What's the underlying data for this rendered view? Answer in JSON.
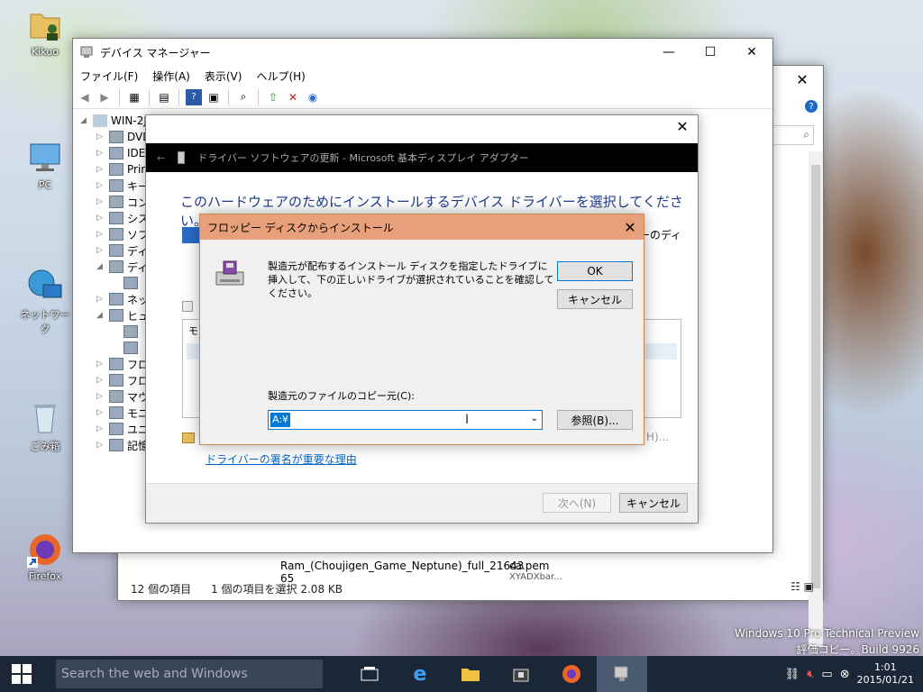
{
  "desktop": {
    "icons": [
      {
        "label": "Kikuo"
      },
      {
        "label": "PC"
      },
      {
        "label": "ネットワーク"
      },
      {
        "label": "ごみ箱"
      },
      {
        "label": "Firefox"
      }
    ],
    "watermark_line1": "Windows 10 Pro Technical Preview",
    "watermark_line2": "評価コピー。Build 9926"
  },
  "explorer": {
    "files": [
      "Ram_(Choujigen_Game_Neptune)_full_21643",
      "65",
      "ca.pem",
      "XYADXbar..."
    ],
    "status_count": "12 個の項目",
    "status_selected": "1 個の項目を選択  2.08 KB"
  },
  "devmgr": {
    "title": "デバイス マネージャー",
    "menu": [
      "ファイル(F)",
      "操作(A)",
      "表示(V)",
      "ヘルプ(H)"
    ],
    "tree_root": "WIN-2J",
    "tree_items": [
      "DVD",
      "IDE",
      "Prin",
      "キー",
      "コン",
      "シス",
      "ソフ",
      "ディ",
      "ディ",
      "",
      "ネッ",
      "ヒュ",
      "",
      "",
      "フロ",
      "フロ",
      "マウ",
      "モニ",
      "ユニ",
      "記憶"
    ]
  },
  "wizard": {
    "header": "ドライバー ソフトウェアの更新 - Microsoft 基本ディスプレイ アダプター",
    "heading": "このハードウェアのためにインストールするデバイス ドライバーを選択してください。",
    "right_text": "ーのディ",
    "list_header": "モ",
    "fragment": "H)...",
    "link": "ドライバーの署名が重要な理由",
    "next_button": "次へ(N)",
    "cancel_button": "キャンセル"
  },
  "floppy": {
    "title": "フロッピー ディスクからインストール",
    "message": "製造元が配布するインストール ディスクを指定したドライブに挿入して、下の正しいドライブが選択されていることを確認してください。",
    "ok_button": "OK",
    "cancel_button": "キャンセル",
    "copy_from_label": "製造元のファイルのコピー元(C):",
    "copy_from_value": "A:¥",
    "browse_button": "参照(B)..."
  },
  "taskbar": {
    "search_placeholder": "Search the web and Windows",
    "time": "1:01",
    "date": "2015/01/21"
  },
  "colors": {
    "accent": "#0078d7",
    "floppy_title": "#e8a07a",
    "taskbar": "#1b2737",
    "wizard_heading": "#1e3a8a"
  }
}
